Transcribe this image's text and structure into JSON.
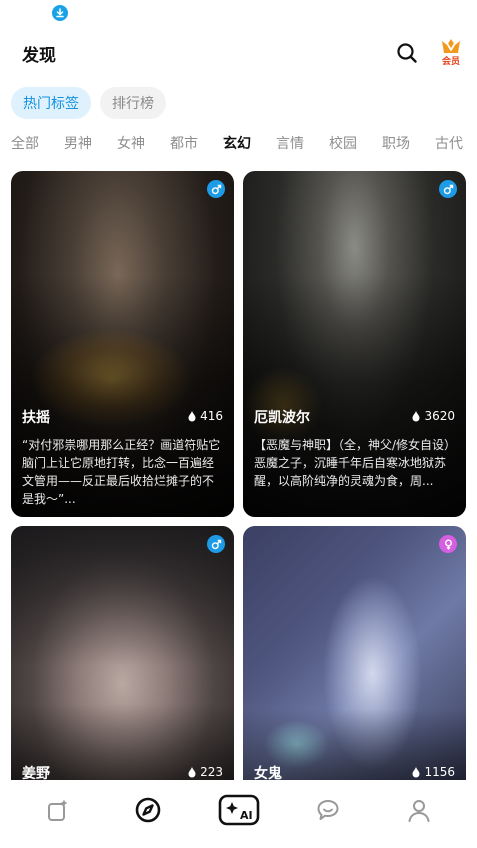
{
  "header": {
    "title": "发现",
    "vip_label": "会员"
  },
  "segments": [
    {
      "label": "热门标签",
      "active": true
    },
    {
      "label": "排行榜",
      "active": false
    }
  ],
  "categories": [
    "全部",
    "男神",
    "女神",
    "都市",
    "玄幻",
    "言情",
    "校园",
    "职场",
    "古代"
  ],
  "active_category": "玄幻",
  "cards": [
    {
      "name": "扶摇",
      "count": "416",
      "gender": "male",
      "description": "“对付邪祟哪用那么正经？画道符贴它脑门上让它原地打转，比念一百遍经文管用——反正最后收拾烂摊子的不是我～”..."
    },
    {
      "name": "厄凯波尔",
      "count": "3620",
      "gender": "male",
      "description": "【恶魔与神职】（全，神父/修女自设）恶魔之子，沉睡千年后自寒冰地狱苏醒，以高阶纯净的灵魂为食，周..."
    },
    {
      "name": "姜野",
      "count": "223",
      "gender": "male",
      "description": ""
    },
    {
      "name": "女鬼",
      "count": "1156",
      "gender": "female",
      "description": ""
    }
  ],
  "colors": {
    "accent": "#1591e0",
    "male_badge": "#1d9be6",
    "female_badge": "#d65ee0",
    "vip": "#e4451d"
  },
  "bottom_nav": [
    "create-icon",
    "discover-icon",
    "ai-icon",
    "chat-icon",
    "profile-icon"
  ]
}
